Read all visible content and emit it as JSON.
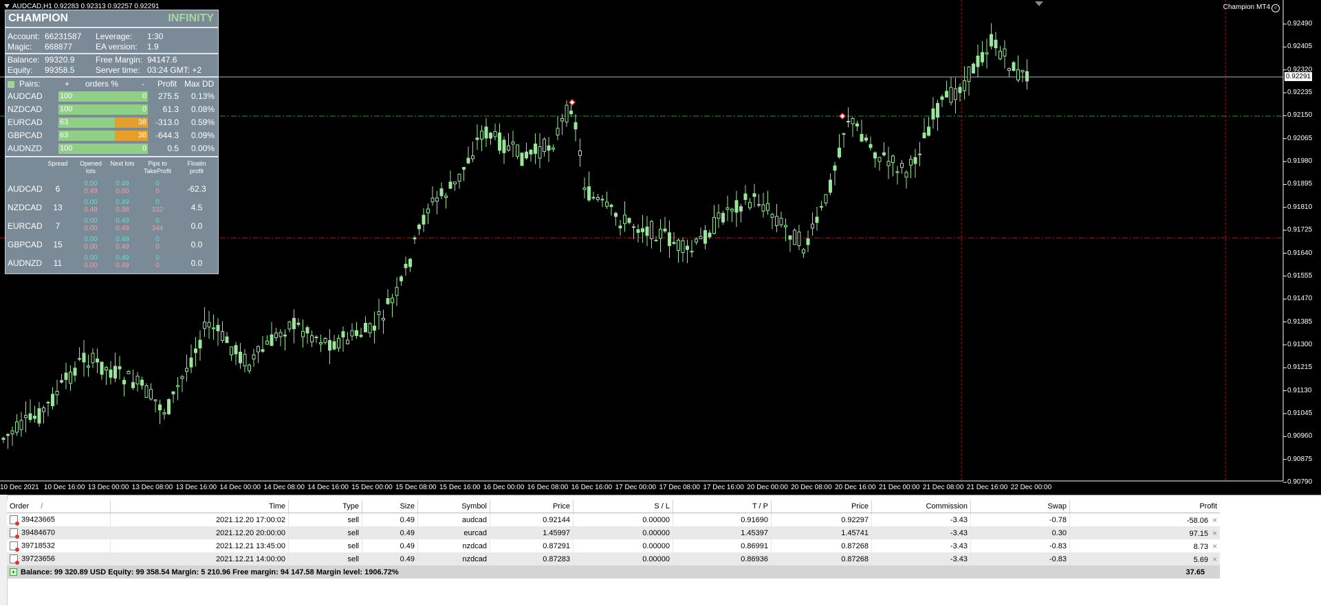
{
  "chart": {
    "title": "AUDCAD,H1  0.92283 0.92313 0.92257 0.92291",
    "ea_label": "Champion MT4",
    "current_price": "0.92291",
    "y_ticks": [
      "0.92490",
      "0.92405",
      "0.92320",
      "0.92235",
      "0.92150",
      "0.92065",
      "0.91980",
      "0.91895",
      "0.91810",
      "0.91725",
      "0.91640",
      "0.91555",
      "0.91470",
      "0.91385",
      "0.91300",
      "0.91215",
      "0.91130",
      "0.91045",
      "0.90960",
      "0.90875",
      "0.90790"
    ],
    "x_ticks": [
      "10 Dec 2021",
      "10 Dec 16:00",
      "13 Dec 00:00",
      "13 Dec 08:00",
      "13 Dec 16:00",
      "14 Dec 00:00",
      "14 Dec 08:00",
      "14 Dec 16:00",
      "15 Dec 00:00",
      "15 Dec 08:00",
      "15 Dec 16:00",
      "16 Dec 00:00",
      "16 Dec 08:00",
      "16 Dec 16:00",
      "17 Dec 00:00",
      "17 Dec 08:00",
      "17 Dec 16:00",
      "20 Dec 00:00",
      "20 Dec 08:00",
      "20 Dec 16:00",
      "21 Dec 00:00",
      "21 Dec 08:00",
      "21 Dec 16:00",
      "22 Dec 00:00"
    ],
    "candle_color": "#98e69a",
    "up_fill": "#000000"
  },
  "panel": {
    "brand": "CHAMPION",
    "brand2": "INFINITY",
    "account_label": "Account:",
    "account_value": "66231587",
    "leverage_label": "Leverage:",
    "leverage_value": "1:30",
    "magic_label": "Magic:",
    "magic_value": "668877",
    "ea_version_label": "EA version:",
    "ea_version_value": "1.9",
    "balance_label": "Balance:",
    "balance_value": "99320.9",
    "free_margin_label": "Free Margin:",
    "free_margin_value": "94147.6",
    "equity_label": "Equity:",
    "equity_value": "99358.5",
    "server_time_label": "Server time:",
    "server_time_value": "03:24 GMT: +2",
    "pairs_header": {
      "pairs": "Pairs:",
      "plus": "+",
      "orders": "orders %",
      "minus": "-",
      "profit": "Profit",
      "maxdd": "Max DD"
    },
    "pairs": [
      {
        "name": "AUDCAD",
        "left": "100",
        "right": "0",
        "fill": 1.0,
        "fill_color": "#8fcf86",
        "profit": "275.5",
        "maxdd": "0.13%"
      },
      {
        "name": "NZDCAD",
        "left": "100",
        "right": "0",
        "fill": 1.0,
        "fill_color": "#8fcf86",
        "profit": "61.3",
        "maxdd": "0.08%"
      },
      {
        "name": "EURCAD",
        "left": "63",
        "right": "38",
        "fill": 0.63,
        "fill_color": "#8fcf86",
        "rest_color": "#e6a02a",
        "profit": "-313.0",
        "maxdd": "0.59%"
      },
      {
        "name": "GBPCAD",
        "left": "63",
        "right": "38",
        "fill": 0.63,
        "fill_color": "#8fcf86",
        "rest_color": "#e6a02a",
        "profit": "-644.3",
        "maxdd": "0.09%"
      },
      {
        "name": "AUDNZD",
        "left": "100",
        "right": "0",
        "fill": 1.0,
        "fill_color": "#8fcf86",
        "profit": "0.5",
        "maxdd": "0.00%"
      }
    ],
    "detail_header": {
      "spread": "Spread",
      "opened": "Opened lots",
      "next": "Next lots",
      "pips": "Pips to TakeProfit",
      "floating": "Floatin profit"
    },
    "details": [
      {
        "name": "AUDCAD",
        "spread": "6",
        "opened_buy": "0.00",
        "opened_sell": "0.49",
        "next_buy": "0.49",
        "next_sell": "0.00",
        "pips_buy": "0",
        "pips_sell": "0",
        "floating": "-62.3"
      },
      {
        "name": "NZDCAD",
        "spread": "13",
        "opened_buy": "0.00",
        "opened_sell": "0.49",
        "next_buy": "0.49",
        "next_sell": "0.98",
        "pips_buy": "0",
        "pips_sell": "332",
        "floating": "4.5"
      },
      {
        "name": "EURCAD",
        "spread": "7",
        "opened_buy": "0.00",
        "opened_sell": "0.00",
        "next_buy": "0.49",
        "next_sell": "0.49",
        "pips_buy": "0",
        "pips_sell": "344",
        "floating": "0.0"
      },
      {
        "name": "GBPCAD",
        "spread": "15",
        "opened_buy": "0.00",
        "opened_sell": "0.00",
        "next_buy": "0.49",
        "next_sell": "0.49",
        "pips_buy": "0",
        "pips_sell": "0",
        "floating": "0.0"
      },
      {
        "name": "AUDNZD",
        "spread": "11",
        "opened_buy": "0.00",
        "opened_sell": "0.00",
        "next_buy": "0.49",
        "next_sell": "0.49",
        "pips_buy": "0",
        "pips_sell": "0",
        "floating": "0.0"
      }
    ]
  },
  "terminal": {
    "columns": [
      "Order",
      "Time",
      "Type",
      "Size",
      "Symbol",
      "Price",
      "S / L",
      "T / P",
      "Price",
      "Commission",
      "Swap",
      "Profit"
    ],
    "sort_indicator": "/",
    "rows": [
      {
        "order": "39423665",
        "time": "2021.12.20 17:00:02",
        "type": "sell",
        "size": "0.49",
        "symbol": "audcad",
        "price": "0.92144",
        "sl": "0.00000",
        "tp": "0.91690",
        "cur_price": "0.92297",
        "commission": "-3.43",
        "swap": "-0.78",
        "profit": "-58.06"
      },
      {
        "order": "39484670",
        "time": "2021.12.20 20:00:00",
        "type": "sell",
        "size": "0.49",
        "symbol": "eurcad",
        "price": "1.45997",
        "sl": "0.00000",
        "tp": "1.45397",
        "cur_price": "1.45741",
        "commission": "-3.43",
        "swap": "0.30",
        "profit": "97.15"
      },
      {
        "order": "39718532",
        "time": "2021.12.21 13:45:00",
        "type": "sell",
        "size": "0.49",
        "symbol": "nzdcad",
        "price": "0.87291",
        "sl": "0.00000",
        "tp": "0.86991",
        "cur_price": "0.87268",
        "commission": "-3.43",
        "swap": "-0.83",
        "profit": "8.73"
      },
      {
        "order": "39723656",
        "time": "2021.12.21 14:00:00",
        "type": "sell",
        "size": "0.49",
        "symbol": "nzdcad",
        "price": "0.87283",
        "sl": "0.00000",
        "tp": "0.86936",
        "cur_price": "0.87268",
        "commission": "-3.43",
        "swap": "-0.83",
        "profit": "5.69"
      }
    ],
    "summary": "Balance: 99 320.89 USD  Equity: 99 358.54  Margin: 5 210.96  Free margin: 94 147.58  Margin level: 1906.72%",
    "total_profit": "37.65",
    "close_glyph": "×"
  }
}
